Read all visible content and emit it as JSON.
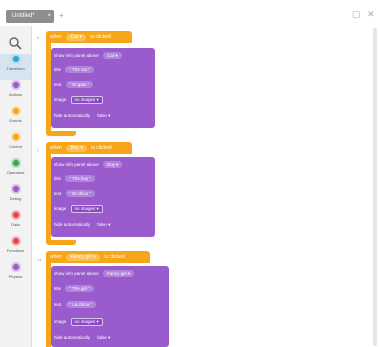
{
  "tab": {
    "label": "Untitled*",
    "close": "×",
    "add": "+"
  },
  "window": {
    "restore_icon": "restore-icon",
    "close_icon": "close-icon"
  },
  "sidebar": {
    "categories": [
      {
        "label": "Transform",
        "color": "#2fa7d9"
      },
      {
        "label": "Actions",
        "color": "#9a5ccc"
      },
      {
        "label": "Events",
        "color": "#f7a61a"
      },
      {
        "label": "Control",
        "color": "#f7a61a"
      },
      {
        "label": "Operators",
        "color": "#36a853"
      },
      {
        "label": "Debug",
        "color": "#9a5ccc"
      },
      {
        "label": "Data",
        "color": "#e5484d"
      },
      {
        "label": "Functions",
        "color": "#e5484d"
      },
      {
        "label": "Physics",
        "color": "#9a5ccc"
      }
    ]
  },
  "blocks": [
    {
      "line": "0",
      "when": "when",
      "object": "Cat",
      "event": "is clicked",
      "panel_label": "show info panel above",
      "panel_object": "Cat",
      "title_label": "title",
      "title_value": "\" The cat \"",
      "text_label": "text",
      "text_value": "\" El gato \"",
      "image_label": "image",
      "image_value": "no images",
      "hide_label": "hide automatically",
      "hide_value": "false"
    },
    {
      "line": "7",
      "when": "when",
      "object": "Boy",
      "event": "is clicked",
      "panel_label": "show info panel above",
      "panel_object": "Boy",
      "title_label": "title",
      "title_value": "\" The boy \"",
      "text_label": "text",
      "text_value": "\" El chico \"",
      "image_label": "image",
      "image_value": "no images",
      "hide_label": "hide automatically",
      "hide_value": "false"
    },
    {
      "line": "14",
      "when": "when",
      "object": "Fancy girl",
      "event": "is clicked",
      "panel_label": "show info panel above",
      "panel_object": "Fancy girl",
      "title_label": "title",
      "title_value": "\" The girl \"",
      "text_label": "text",
      "text_value": "\" La chica \"",
      "image_label": "image",
      "image_value": "no images",
      "hide_label": "hide automatically",
      "hide_value": "false"
    }
  ]
}
